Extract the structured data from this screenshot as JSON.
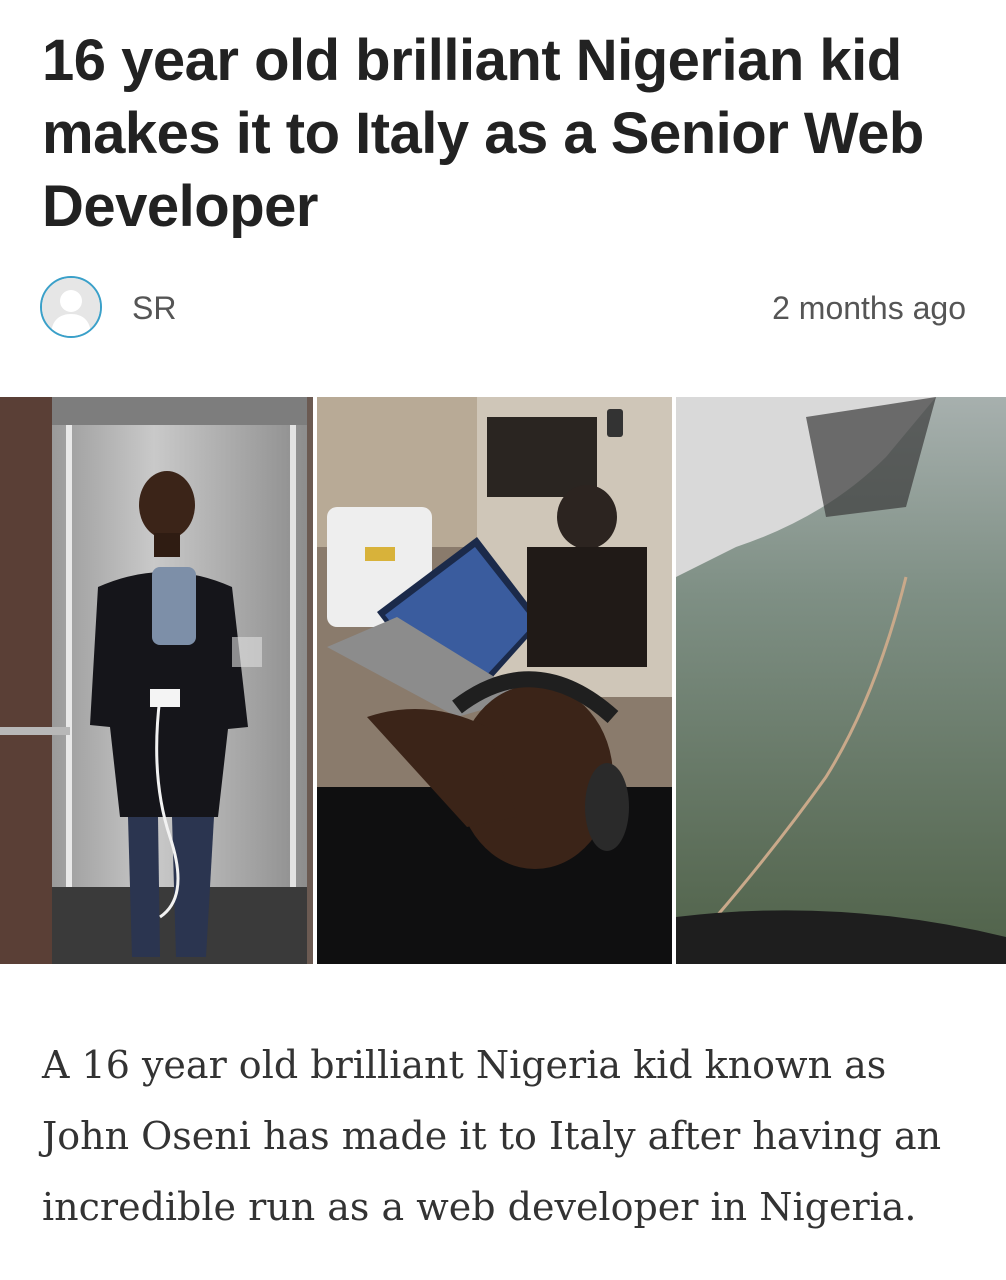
{
  "article": {
    "title": "16 year old brilliant Nigerian kid makes it to Italy as a Senior Web Developer",
    "author": "SR",
    "posted": "2 months ago",
    "avatar_icon": "user-placeholder-icon",
    "accent_color": "#3aa0c9",
    "paragraph": "A 16 year old brilliant Nigeria kid known as John Oseni has made it to Italy after having an incredible run as a web developer in Nigeria."
  }
}
